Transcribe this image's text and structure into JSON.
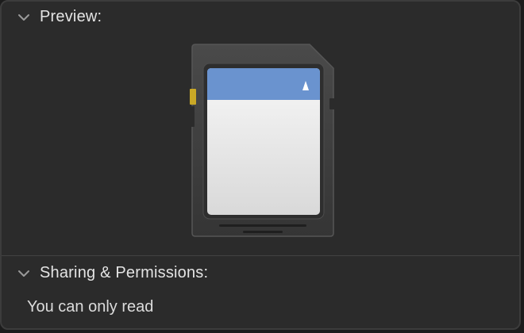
{
  "preview": {
    "header": "Preview:",
    "icon": "sd-card-icon"
  },
  "sharing": {
    "header": "Sharing & Permissions:",
    "text": "You can only read"
  },
  "colors": {
    "background": "#2b2b2b",
    "label_bar": "#6a93cf",
    "card_body": "#3c3c3c",
    "contact": "#c9a826"
  }
}
